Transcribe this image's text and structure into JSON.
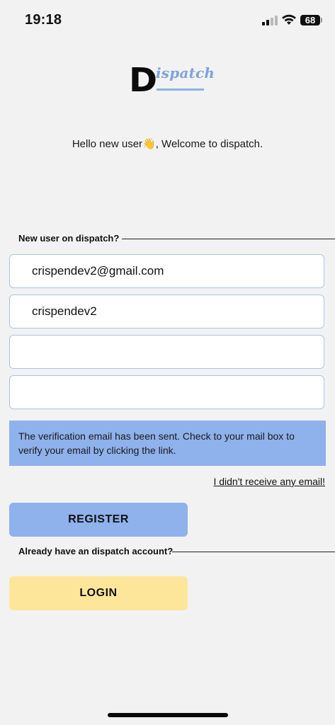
{
  "status_bar": {
    "time": "19:18",
    "battery": "68"
  },
  "logo": {
    "letter": "D",
    "word": "ispatch"
  },
  "welcome": {
    "text_before": "Hello new user",
    "emoji": "👋",
    "text_after": ", Welcome to dispatch."
  },
  "register_section": {
    "label": "New user on dispatch?"
  },
  "form": {
    "email_value": "crispendev2@gmail.com",
    "username_value": "crispendev2",
    "password_value": "",
    "confirm_password_value": ""
  },
  "notice": {
    "text": "The verification email has been sent. Check to your mail box to verify your email by clicking the link."
  },
  "resend_link": "I didn't receive any email!",
  "register_button": "REGISTER",
  "login_section": {
    "label": "Already have an dispatch account?"
  },
  "login_button": "LOGIN",
  "colors": {
    "accent_blue": "#8fb1ec",
    "accent_yellow": "#fde69a",
    "background": "#f2f2f2"
  }
}
